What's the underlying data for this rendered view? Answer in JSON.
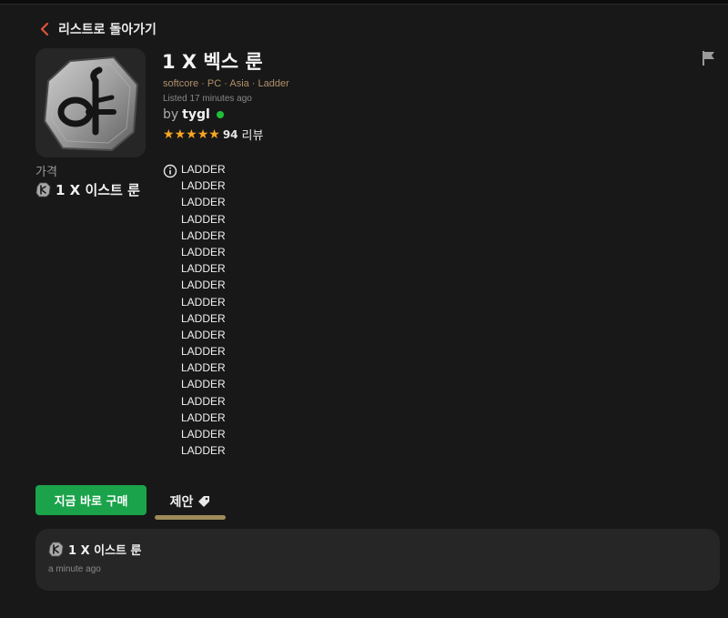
{
  "nav": {
    "back_label": "리스트로 돌아가기"
  },
  "listing": {
    "title": "1 X 벡스 룬",
    "meta": "softcore · PC · Asia · Ladder",
    "listed": "Listed 17 minutes ago",
    "seller_prefix": "by",
    "seller_name": "tygl",
    "rating_count": "94",
    "rating_label": "리뷰",
    "stars": 5
  },
  "price": {
    "label": "가격",
    "value": "1 X 이스트 룬"
  },
  "description": {
    "lines": [
      "LADDER",
      "LADDER",
      "LADDER",
      "LADDER",
      "LADDER",
      "LADDER",
      "LADDER",
      "LADDER",
      "LADDER",
      "LADDER",
      "LADDER",
      "LADDER",
      "LADDER",
      "LADDER",
      "LADDER",
      "LADDER",
      "LADDER",
      "LADDER"
    ]
  },
  "actions": {
    "buy_label": "지금 바로 구매",
    "offer_tab_label": "제안"
  },
  "offers": [
    {
      "item": "1 X 이스트 룬",
      "time": "a minute ago"
    }
  ],
  "colors": {
    "background": "#181818",
    "buy": "#1aa34a",
    "accent": "#9e8a5a",
    "star": "#f5a623",
    "online": "#1fbf3a",
    "back_chevron": "#e0533a"
  }
}
